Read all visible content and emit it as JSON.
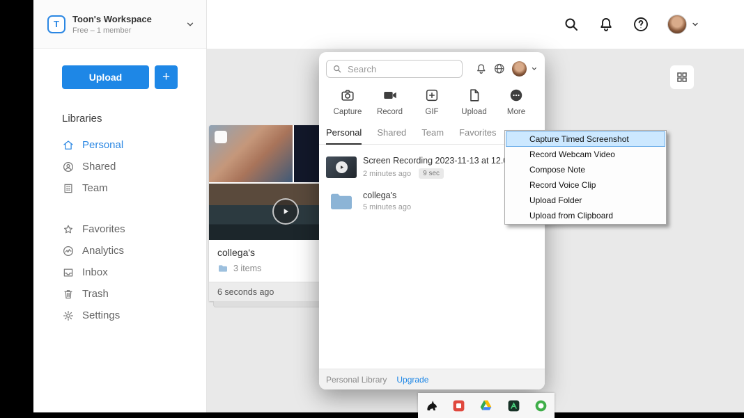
{
  "workspace": {
    "initial": "T",
    "name": "Toon's Workspace",
    "plan": "Free – 1 member"
  },
  "sidebar": {
    "upload_label": "Upload",
    "add_label": "+",
    "libraries_heading": "Libraries",
    "library_items": [
      {
        "label": "Personal",
        "active": true
      },
      {
        "label": "Shared"
      },
      {
        "label": "Team"
      }
    ],
    "nav_items": [
      {
        "label": "Favorites"
      },
      {
        "label": "Analytics"
      },
      {
        "label": "Inbox"
      },
      {
        "label": "Trash"
      },
      {
        "label": "Settings"
      }
    ]
  },
  "main": {
    "card": {
      "title": "collega's",
      "items_count": "3 items",
      "timestamp": "6 seconds ago"
    }
  },
  "popup": {
    "search_placeholder": "Search",
    "actions": [
      {
        "label": "Capture"
      },
      {
        "label": "Record"
      },
      {
        "label": "GIF"
      },
      {
        "label": "Upload"
      },
      {
        "label": "More"
      }
    ],
    "tabs": [
      {
        "label": "Personal",
        "active": true
      },
      {
        "label": "Shared"
      },
      {
        "label": "Team"
      },
      {
        "label": "Favorites"
      }
    ],
    "files": [
      {
        "title": "Screen Recording 2023-11-13 at 12.08...",
        "time": "2 minutes ago",
        "badge": "9 sec"
      },
      {
        "title": "collega's",
        "time": "5 minutes ago"
      }
    ],
    "footer": {
      "library_label": "Personal Library",
      "upgrade_label": "Upgrade"
    }
  },
  "context_menu": {
    "items": [
      {
        "label": "Capture Timed Screenshot",
        "highlighted": true
      },
      {
        "label": "Record Webcam Video"
      },
      {
        "label": "Compose Note"
      },
      {
        "label": "Record Voice Clip"
      },
      {
        "label": "Upload Folder"
      },
      {
        "label": "Upload from Clipboard"
      }
    ]
  },
  "colors": {
    "accent": "#1e87e6",
    "sidebar_active": "#2b87e3",
    "menu_highlight": "#cce8ff",
    "menu_highlight_border": "#62a8e8"
  }
}
